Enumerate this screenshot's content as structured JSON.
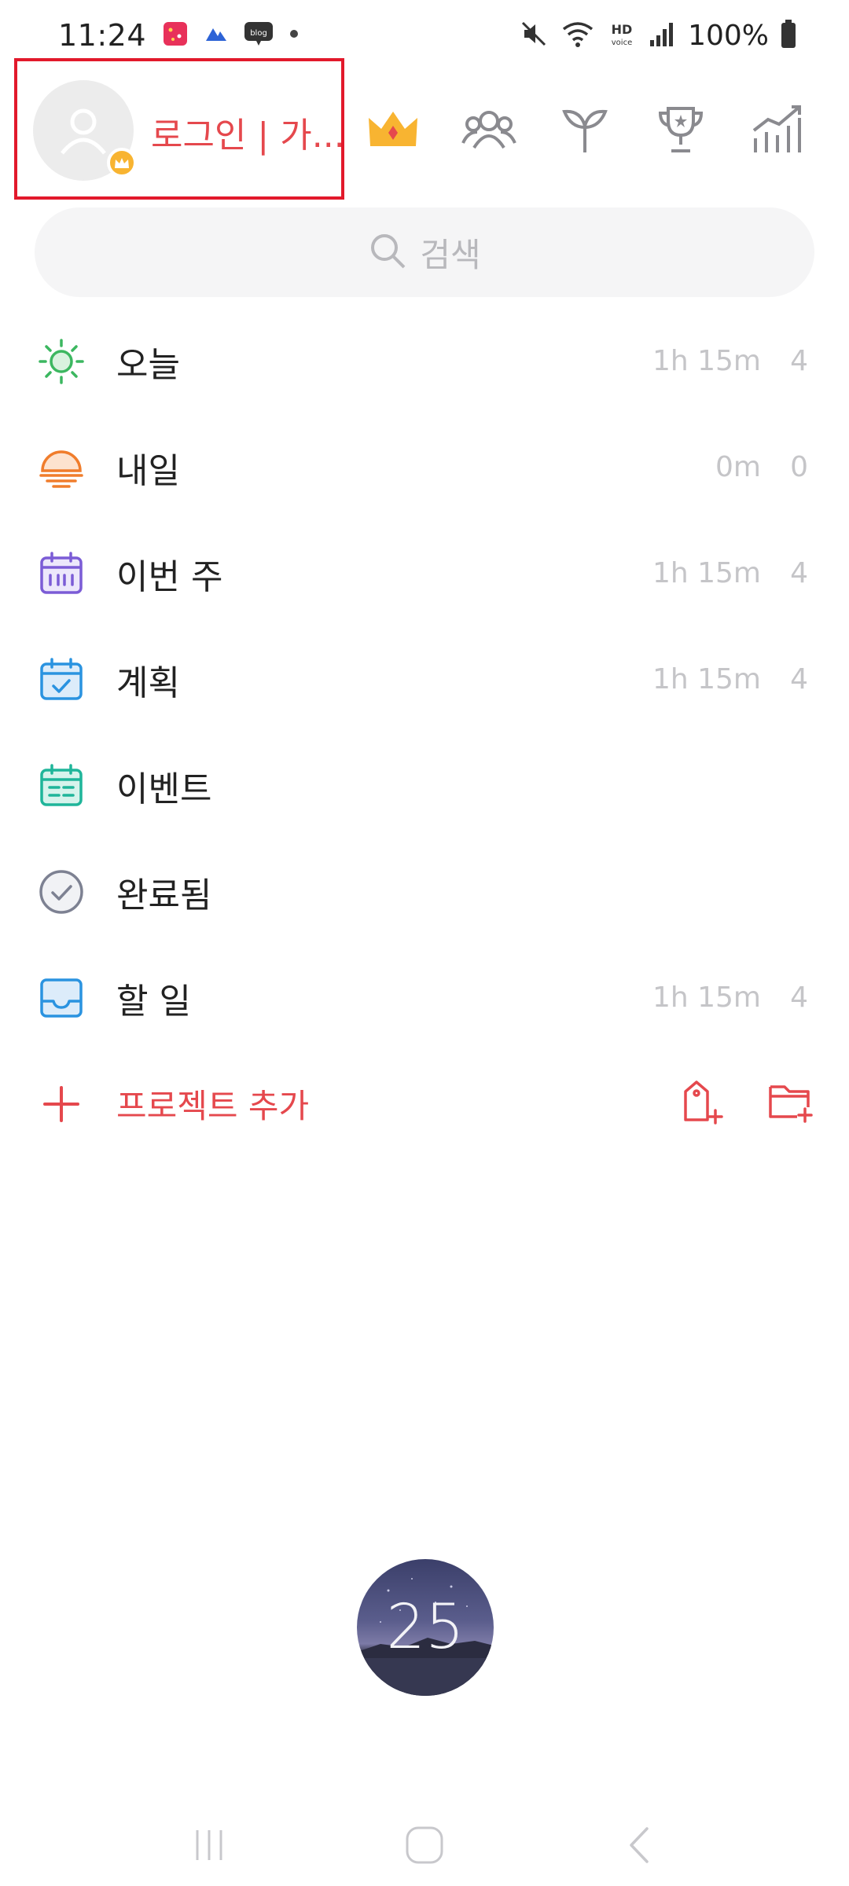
{
  "status": {
    "time": "11:24",
    "battery": "100%",
    "notifs": [
      "calendar-notif",
      "app-notif",
      "blog"
    ],
    "blog_label": "blog"
  },
  "profile": {
    "login_label": "로그인 | 가..."
  },
  "header_icons": [
    "crown-icon",
    "group-icon",
    "sprout-icon",
    "trophy-icon",
    "stats-icon"
  ],
  "search": {
    "placeholder": "검색"
  },
  "lists": [
    {
      "label": "오늘",
      "time": "1h 15m",
      "count": "4",
      "icon": "sun-icon",
      "color": "#3cb760"
    },
    {
      "label": "내일",
      "time": "0m",
      "count": "0",
      "icon": "sunrise-icon",
      "color": "#f07d2c"
    },
    {
      "label": "이번 주",
      "time": "1h 15m",
      "count": "4",
      "icon": "calendar-week-icon",
      "color": "#7b5cd6"
    },
    {
      "label": "계획",
      "time": "1h 15m",
      "count": "4",
      "icon": "calendar-check-icon",
      "color": "#2a93e0"
    },
    {
      "label": "이벤트",
      "time": "",
      "count": "",
      "icon": "calendar-event-icon",
      "color": "#1fb59a"
    },
    {
      "label": "완료됨",
      "time": "",
      "count": "",
      "icon": "check-circle-icon",
      "color": "#7d8192"
    },
    {
      "label": "할 일",
      "time": "1h 15m",
      "count": "4",
      "icon": "inbox-icon",
      "color": "#2a93e0"
    }
  ],
  "add_project": {
    "label": "프로젝트 추가",
    "color": "#e5484d"
  },
  "timer": {
    "value": "25"
  },
  "colors": {
    "accent": "#e5484d",
    "highlight_border": "#e2192b",
    "crown": "#f8b431",
    "muted": "#c5c5c8"
  }
}
